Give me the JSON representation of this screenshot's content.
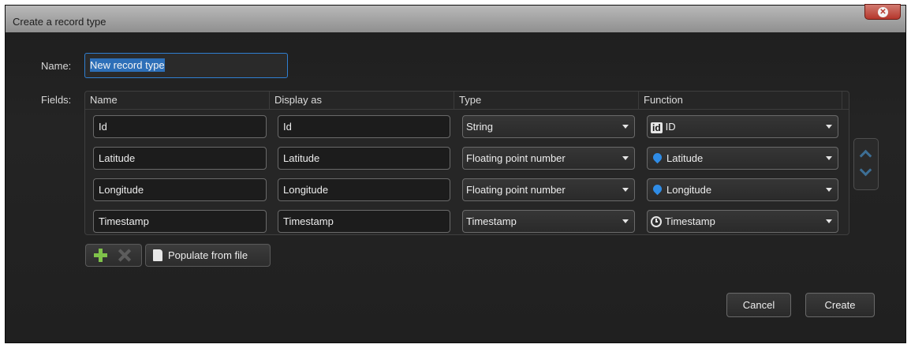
{
  "window": {
    "title": "Create a record type"
  },
  "form": {
    "name_label": "Name:",
    "name_value": "New record type",
    "fields_label": "Fields:"
  },
  "columns": [
    "Name",
    "Display as",
    "Type",
    "Function"
  ],
  "rows": [
    {
      "name": "Id",
      "display": "Id",
      "type": "String",
      "function": "ID",
      "function_icon": "id-icon"
    },
    {
      "name": "Latitude",
      "display": "Latitude",
      "type": "Floating point number",
      "function": "Latitude",
      "function_icon": "map-pin-icon"
    },
    {
      "name": "Longitude",
      "display": "Longitude",
      "type": "Floating point number",
      "function": "Longitude",
      "function_icon": "map-pin-icon"
    },
    {
      "name": "Timestamp",
      "display": "Timestamp",
      "type": "Timestamp",
      "function": "Timestamp",
      "function_icon": "clock-icon"
    }
  ],
  "toolbar": {
    "populate_label": "Populate from file"
  },
  "buttons": {
    "cancel": "Cancel",
    "create": "Create"
  },
  "colors": {
    "accent": "#2f7fd1",
    "close": "#b5372c",
    "add": "#7fc24a",
    "pin": "#2f8ce6"
  }
}
